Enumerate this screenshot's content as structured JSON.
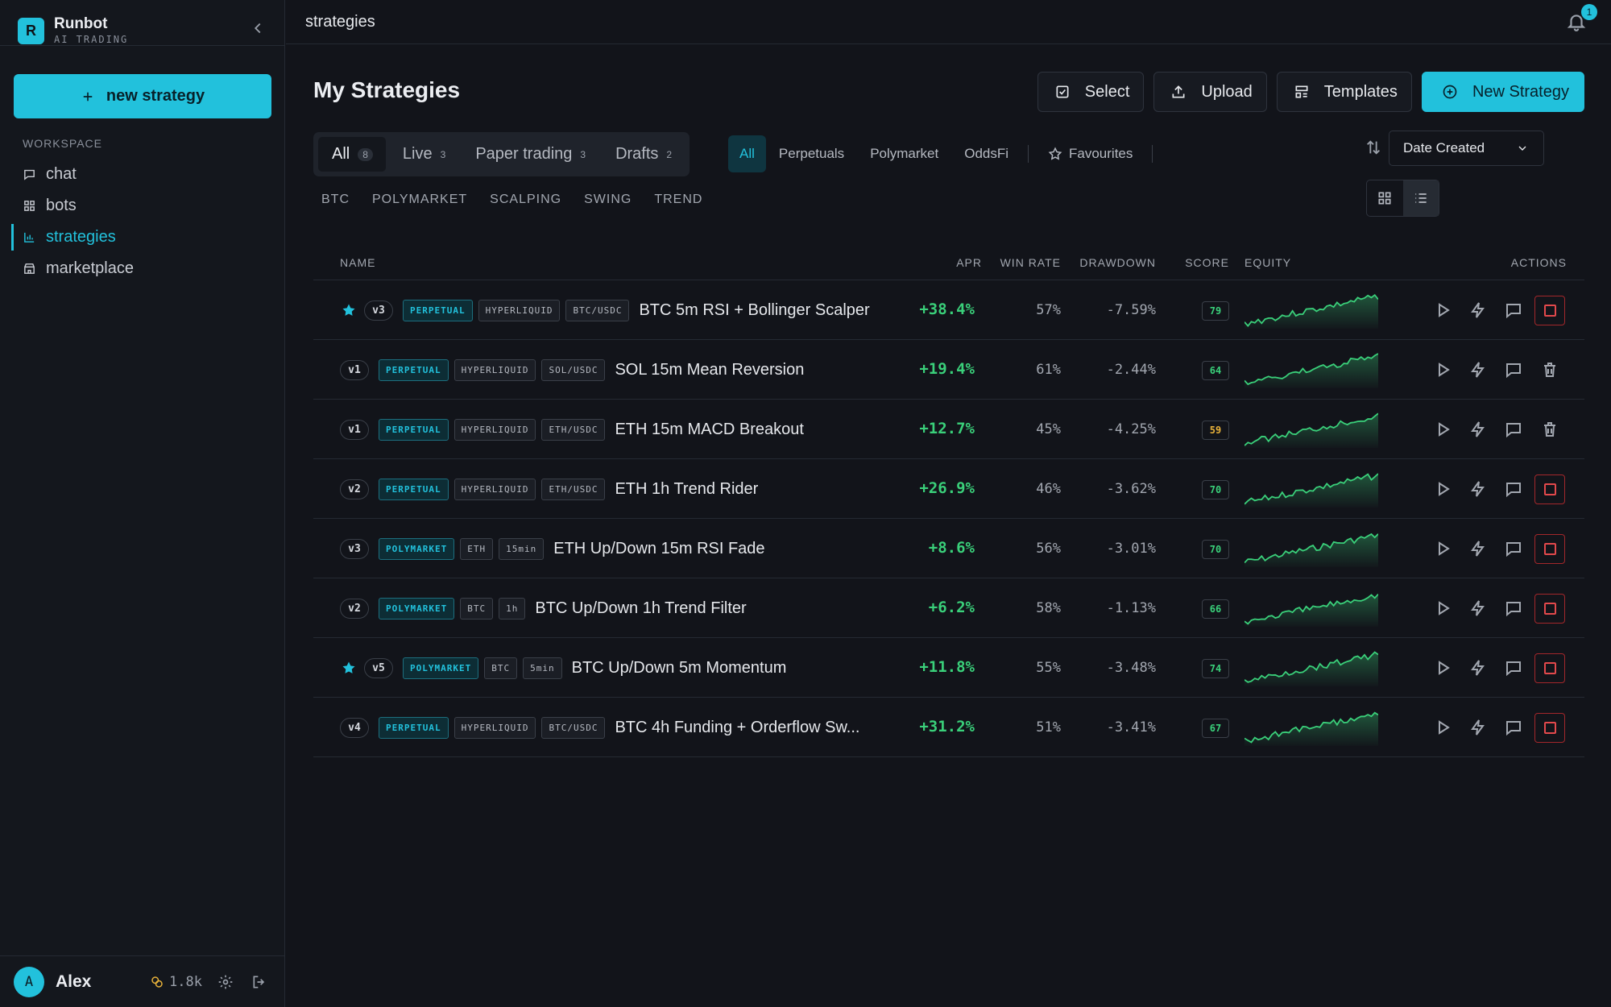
{
  "brand": {
    "name": "Runbot",
    "subtitle": "AI TRADING",
    "logo_letter": "R"
  },
  "sidebar": {
    "new_button": "new strategy",
    "section_label": "WORKSPACE",
    "items": [
      {
        "label": "chat",
        "icon": "chat-icon"
      },
      {
        "label": "bots",
        "icon": "grid-icon"
      },
      {
        "label": "strategies",
        "icon": "bar-chart-icon",
        "active": true
      },
      {
        "label": "marketplace",
        "icon": "store-icon"
      }
    ],
    "user": {
      "initial": "A",
      "name": "Alex",
      "credits": "1.8k"
    }
  },
  "topbar": {
    "crumb": "strategies",
    "notifications": "1"
  },
  "page": {
    "title": "My Strategies",
    "actions": {
      "select": "Select",
      "upload": "Upload",
      "templates": "Templates",
      "new": "New Strategy"
    },
    "status_tabs": [
      {
        "label": "All",
        "count": "8",
        "active": true
      },
      {
        "label": "Live",
        "count": "3"
      },
      {
        "label": "Paper trading",
        "count": "3"
      },
      {
        "label": "Drafts",
        "count": "2"
      }
    ],
    "market_tabs": [
      "All",
      "Perpetuals",
      "Polymarket",
      "OddsFi"
    ],
    "favourites": "Favourites",
    "tag_filters": [
      "BTC",
      "POLYMARKET",
      "SCALPING",
      "SWING",
      "TREND"
    ],
    "sort": "Date Created"
  },
  "table": {
    "headers": {
      "name": "NAME",
      "apr": "APR",
      "win_rate": "WIN RATE",
      "drawdown": "DRAWDOWN",
      "score": "SCORE",
      "equity": "EQUITY",
      "actions": "ACTIONS"
    },
    "rows": [
      {
        "star": true,
        "version": "v3",
        "tags": [
          "PERPETUAL",
          "HYPERLIQUID",
          "BTC/USDC"
        ],
        "name": "BTC 5m RSI + Bollinger Scalper",
        "apr": "+38.4%",
        "win_rate": "57%",
        "drawdown": "-7.59%",
        "score": "79",
        "score_color": "#3ad07a",
        "last": "stop"
      },
      {
        "star": false,
        "version": "v1",
        "tags": [
          "PERPETUAL",
          "HYPERLIQUID",
          "SOL/USDC"
        ],
        "name": "SOL 15m Mean Reversion",
        "apr": "+19.4%",
        "win_rate": "61%",
        "drawdown": "-2.44%",
        "score": "64",
        "score_color": "#3ad07a",
        "last": "delete"
      },
      {
        "star": false,
        "version": "v1",
        "tags": [
          "PERPETUAL",
          "HYPERLIQUID",
          "ETH/USDC"
        ],
        "name": "ETH 15m MACD Breakout",
        "apr": "+12.7%",
        "win_rate": "45%",
        "drawdown": "-4.25%",
        "score": "59",
        "score_color": "#e8b23a",
        "last": "delete"
      },
      {
        "star": false,
        "version": "v2",
        "tags": [
          "PERPETUAL",
          "HYPERLIQUID",
          "ETH/USDC"
        ],
        "name": "ETH 1h Trend Rider",
        "apr": "+26.9%",
        "win_rate": "46%",
        "drawdown": "-3.62%",
        "score": "70",
        "score_color": "#3ad07a",
        "last": "stop"
      },
      {
        "star": false,
        "version": "v3",
        "tags": [
          "POLYMARKET",
          "ETH",
          "15min"
        ],
        "name": "ETH Up/Down 15m RSI Fade",
        "apr": "+8.6%",
        "win_rate": "56%",
        "drawdown": "-3.01%",
        "score": "70",
        "score_color": "#3ad07a",
        "last": "stop"
      },
      {
        "star": false,
        "version": "v2",
        "tags": [
          "POLYMARKET",
          "BTC",
          "1h"
        ],
        "name": "BTC Up/Down 1h Trend Filter",
        "apr": "+6.2%",
        "win_rate": "58%",
        "drawdown": "-1.13%",
        "score": "66",
        "score_color": "#3ad07a",
        "last": "stop"
      },
      {
        "star": true,
        "version": "v5",
        "tags": [
          "POLYMARKET",
          "BTC",
          "5min"
        ],
        "name": "BTC Up/Down 5m Momentum",
        "apr": "+11.8%",
        "win_rate": "55%",
        "drawdown": "-3.48%",
        "score": "74",
        "score_color": "#3ad07a",
        "last": "stop"
      },
      {
        "star": false,
        "version": "v4",
        "tags": [
          "PERPETUAL",
          "HYPERLIQUID",
          "BTC/USDC"
        ],
        "name": "BTC 4h Funding + Orderflow Sw...",
        "apr": "+31.2%",
        "win_rate": "51%",
        "drawdown": "-3.41%",
        "score": "67",
        "score_color": "#3ad07a",
        "last": "stop"
      }
    ]
  },
  "colors": {
    "accent": "#22c1dc",
    "positive": "#3ad07a",
    "danger": "#e2494c",
    "background": "#12141a"
  }
}
